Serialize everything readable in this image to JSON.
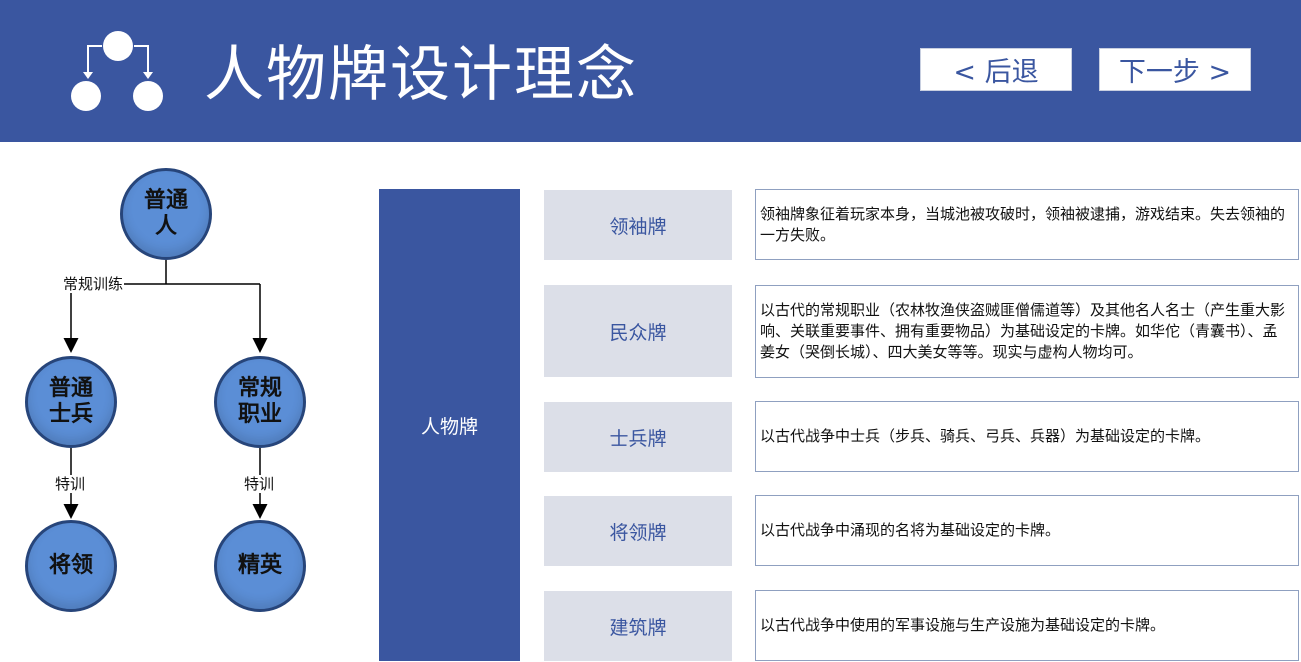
{
  "header": {
    "title": "人物牌设计理念",
    "back_label": "< 后退",
    "next_label": "下一步 >"
  },
  "flowchart": {
    "nodes": {
      "root": "普通人",
      "soldier": "普通士兵",
      "profession": "常规职业",
      "general": "将领",
      "elite": "精英"
    },
    "edge_labels": {
      "regular_training": "常规训练",
      "special_training_left": "特训",
      "special_training_right": "特训"
    }
  },
  "card_panel": {
    "main_label": "人物牌",
    "rows": [
      {
        "category": "领袖牌",
        "description": "领袖牌象征着玩家本身，当城池被攻破时，领袖被逮捕，游戏结束。失去领袖的一方失败。"
      },
      {
        "category": "民众牌",
        "description": "以古代的常规职业（农林牧渔侠盗贼匪僧儒道等）及其他名人名士（产生重大影响、关联重要事件、拥有重要物品）为基础设定的卡牌。如华佗（青囊书）、孟姜女（哭倒长城）、四大美女等等。现实与虚构人物均可。"
      },
      {
        "category": "士兵牌",
        "description": "以古代战争中士兵（步兵、骑兵、弓兵、兵器）为基础设定的卡牌。"
      },
      {
        "category": "将领牌",
        "description": "以古代战争中涌现的名将为基础设定的卡牌。"
      },
      {
        "category": "建筑牌",
        "description": "以古代战争中使用的军事设施与生产设施为基础设定的卡牌。"
      }
    ]
  },
  "colors": {
    "brand_blue": "#3a56a0",
    "node_fill": "#5b8ed6",
    "category_bg": "#dcdfe8"
  }
}
